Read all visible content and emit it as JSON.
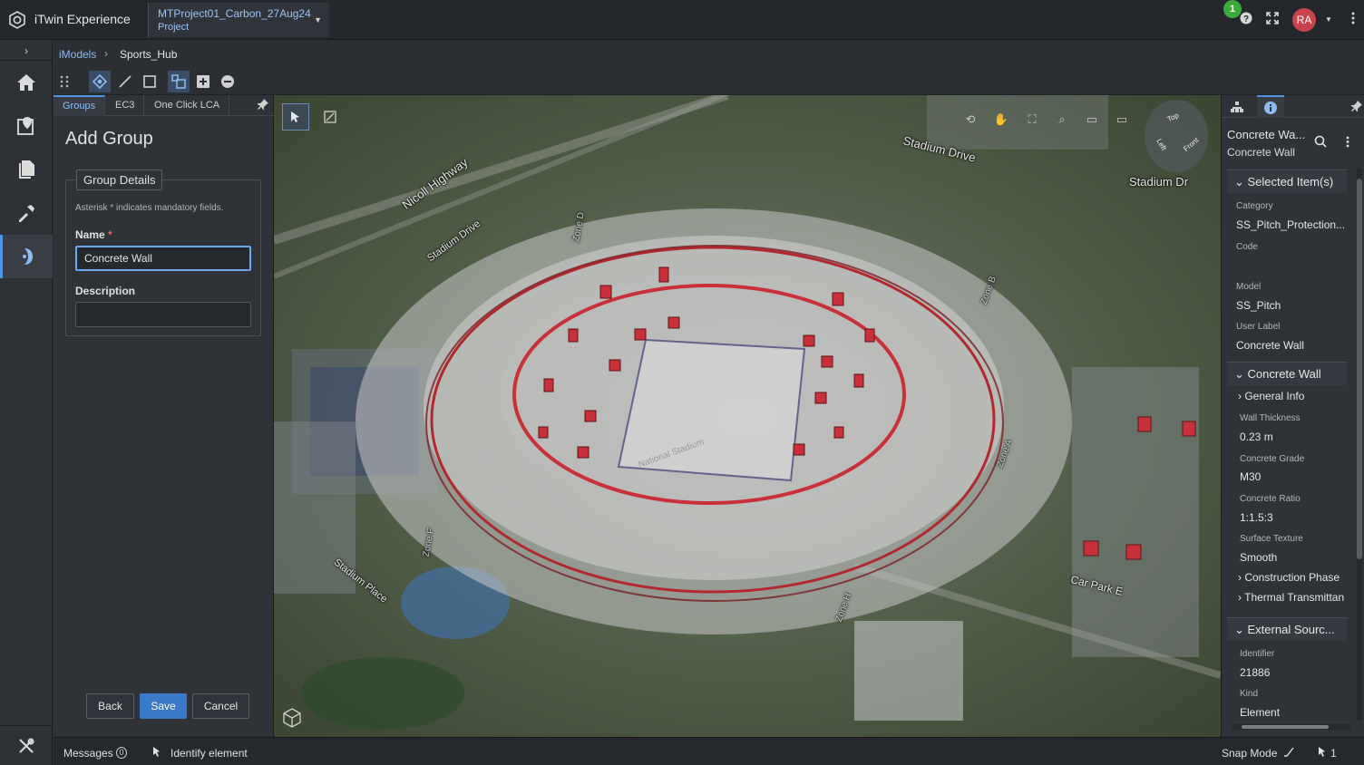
{
  "app": {
    "title": "iTwin Experience",
    "project_name": "MTProject01_Carbon_27Aug24",
    "project_sub": "Project",
    "notification_count": "1",
    "avatar_initials": "RA"
  },
  "breadcrumb": {
    "root": "iModels",
    "current": "Sports_Hub"
  },
  "left_panel": {
    "tabs": [
      "Groups",
      "EC3",
      "One Click LCA"
    ],
    "title": "Add Group",
    "legend": "Group Details",
    "hint": "Asterisk * indicates mandatory fields.",
    "name_label": "Name",
    "name_required": "*",
    "name_value": "Concrete Wall",
    "description_label": "Description",
    "description_value": "",
    "buttons": {
      "back": "Back",
      "save": "Save",
      "cancel": "Cancel"
    }
  },
  "viewport": {
    "map_labels": [
      "Stadium Drive",
      "Nicoll Highway",
      "Stadium Drive",
      "Stadium Dr",
      "Car Park E",
      "Stadium Place",
      "Zone D",
      "Zone B",
      "Zone A",
      "Zone F",
      "Zone H",
      "National Stadium"
    ],
    "nav_cube": {
      "top": "Top",
      "left": "Left",
      "front": "Front"
    }
  },
  "right_panel": {
    "title": "Concrete Wa...",
    "subtitle": "Concrete Wall",
    "selected_items": {
      "header": "Selected Item(s)",
      "category_label": "Category",
      "category_value": "SS_Pitch_Protection...",
      "code_label": "Code",
      "code_value": "",
      "model_label": "Model",
      "model_value": "SS_Pitch",
      "user_label_label": "User Label",
      "user_label_value": "Concrete Wall"
    },
    "concrete_wall": {
      "header": "Concrete Wall",
      "general_info": "General Info",
      "wall_thickness_label": "Wall Thickness",
      "wall_thickness_value": "0.23 m",
      "concrete_grade_label": "Concrete Grade",
      "concrete_grade_value": "M30",
      "concrete_ratio_label": "Concrete Ratio",
      "concrete_ratio_value": "1:1.5:3",
      "surface_texture_label": "Surface Texture",
      "surface_texture_value": "Smooth",
      "construction_phase": "Construction Phase",
      "thermal_transmittance": "Thermal Transmittan"
    },
    "external_source": {
      "header": "External Sourc...",
      "identifier_label": "Identifier",
      "identifier_value": "21886",
      "kind_label": "Kind",
      "kind_value": "Element"
    }
  },
  "status_bar": {
    "messages": "Messages",
    "messages_count": "0",
    "identify": "Identify element",
    "snap_mode": "Snap Mode",
    "selection_count": "1"
  },
  "colors": {
    "accent": "#4f95e4",
    "primary_button": "#3b79c9",
    "selection": "#c8313a"
  }
}
